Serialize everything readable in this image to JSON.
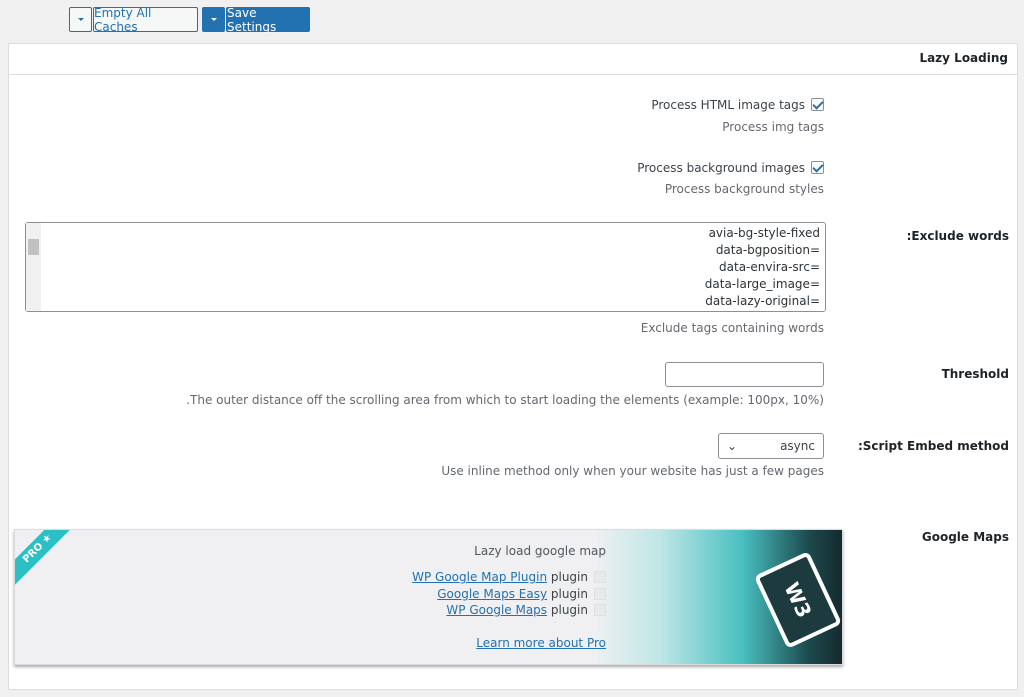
{
  "toolbar": {
    "empty_caches": "Empty All Caches",
    "save_settings": "Save Settings"
  },
  "section": {
    "title": "Lazy Loading"
  },
  "process_html": {
    "label": "Process HTML image tags",
    "checked": true,
    "desc": "Process img tags"
  },
  "process_bg": {
    "label": "Process background images",
    "checked": true,
    "desc": "Process background styles"
  },
  "exclude": {
    "label": ":Exclude words",
    "value": "avia-bg-style-fixed\n=data-bgposition\n=data-envira-src\n=data-large_image\n=data-lazy-original",
    "desc": "Exclude tags containing words"
  },
  "threshold": {
    "label": "Threshold",
    "value": "",
    "desc": ".The outer distance off the scrolling area from which to start loading the elements (example: 100px, 10%)"
  },
  "embed": {
    "label": ":Script Embed method",
    "value": "async",
    "desc": "Use inline method only when your website has just a few pages"
  },
  "google_maps": {
    "label": "Google Maps",
    "ribbon": "PRO ★",
    "title": "Lazy load google map",
    "plugins": [
      {
        "name": "WP Google Map Plugin",
        "suffix": "plugin"
      },
      {
        "name": "Google Maps Easy",
        "suffix": "plugin"
      },
      {
        "name": "WP Google Maps",
        "suffix": "plugin"
      }
    ],
    "learn_more": "Learn more about Pro",
    "logo": "W3"
  },
  "colors": {
    "accent": "#2271b1",
    "ribbon": "#2cbfc4"
  }
}
